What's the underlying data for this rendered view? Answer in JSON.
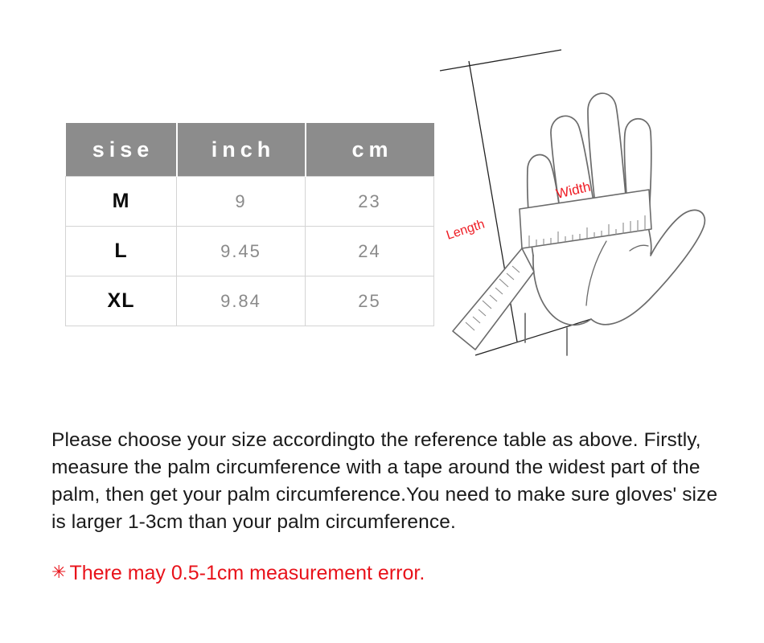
{
  "table": {
    "headers": [
      "sise",
      "inch",
      "cm"
    ],
    "rows": [
      {
        "size": "M",
        "inch": "9",
        "cm": "23"
      },
      {
        "size": "L",
        "inch": "9.45",
        "cm": "24"
      },
      {
        "size": "XL",
        "inch": "9.84",
        "cm": "25"
      }
    ],
    "header_bg": "#8c8c8c",
    "header_text_color": "#ffffff",
    "value_text_color": "#8a8a8a",
    "border_color": "#d4d4d4"
  },
  "diagram": {
    "length_label": "Length",
    "width_label": "Width",
    "label_color": "#ee1c24",
    "line_color": "#5a5a5a",
    "guide_color": "#222222"
  },
  "instructions": {
    "text": "Please choose your size accordingto the reference table as above. Firstly, measure the palm circumference with a tape around the widest part of the palm, then get your palm circumference.You need to make sure gloves' size is larger 1-3cm than your palm circumference."
  },
  "note": {
    "asterisk": "✳",
    "text": "There may 0.5-1cm measurement error.",
    "color": "#e8121a"
  }
}
